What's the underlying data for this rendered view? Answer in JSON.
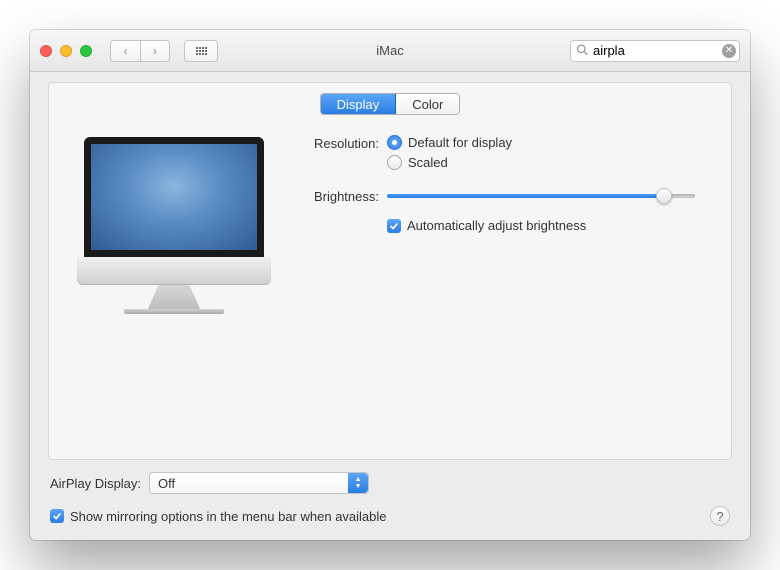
{
  "window": {
    "title": "iMac"
  },
  "search": {
    "value": "airpla"
  },
  "tabs": {
    "display": "Display",
    "color": "Color"
  },
  "resolution": {
    "label": "Resolution:",
    "default": "Default for display",
    "scaled": "Scaled"
  },
  "brightness": {
    "label": "Brightness:",
    "auto": "Automatically adjust brightness"
  },
  "airplay": {
    "label": "AirPlay Display:",
    "value": "Off"
  },
  "mirroring": {
    "label": "Show mirroring options in the menu bar when available"
  },
  "help": {
    "label": "?"
  }
}
